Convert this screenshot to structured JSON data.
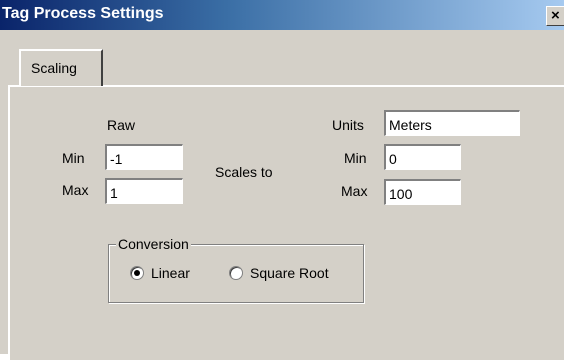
{
  "window": {
    "title": "Tag Process Settings",
    "close_glyph": "×"
  },
  "tabs": [
    {
      "label": "Scaling",
      "active": true
    }
  ],
  "raw": {
    "heading": "Raw",
    "min_label": "Min",
    "min_value": "-1",
    "max_label": "Max",
    "max_value": "1"
  },
  "scales_to_label": "Scales to",
  "scaled": {
    "units_label": "Units",
    "units_value": "Meters",
    "min_label": "Min",
    "min_value": "0",
    "max_label": "Max",
    "max_value": "100"
  },
  "conversion": {
    "title": "Conversion",
    "options": [
      {
        "label": "Linear",
        "selected": true
      },
      {
        "label": "Square Root",
        "selected": false
      }
    ]
  }
}
